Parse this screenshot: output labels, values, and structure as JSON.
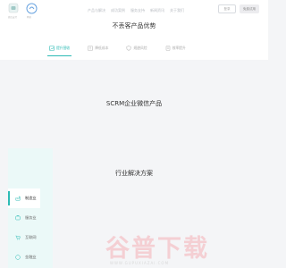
{
  "header": {
    "logo_a_label": "微信支付",
    "logo_b_label": "网易",
    "nav": [
      "产品与解决",
      "成功案例",
      "服务支持",
      "新闻资讯",
      "关于我们"
    ],
    "login_label": "登录",
    "cta_label": "免费试用"
  },
  "section1": {
    "title": "不丢客产品优势",
    "tabs": [
      {
        "label": "提升营收",
        "icon": "chart-icon",
        "active": true
      },
      {
        "label": "降低成本",
        "icon": "cost-icon",
        "active": false
      },
      {
        "label": "规避风险",
        "icon": "shield-icon",
        "active": false
      },
      {
        "label": "效率提升",
        "icon": "doc-icon",
        "active": false
      }
    ]
  },
  "section2": {
    "title": "SCRM企业微信产品"
  },
  "section3": {
    "title": "行业解决方案",
    "sidebar": [
      {
        "label": "制造业",
        "icon": "factory-icon",
        "active": true
      },
      {
        "label": "服务业",
        "icon": "service-icon",
        "active": false
      },
      {
        "label": "互联网",
        "icon": "cart-icon",
        "active": false
      },
      {
        "label": "金融业",
        "icon": "coin-icon",
        "active": false
      }
    ]
  },
  "watermark": {
    "text": "谷普下载",
    "sub": "WWW.GUPUXIAZAI.COM"
  },
  "colors": {
    "accent": "#2dbbb5",
    "panel": "#ebf9f8",
    "watermark": "#f5c6cb"
  }
}
